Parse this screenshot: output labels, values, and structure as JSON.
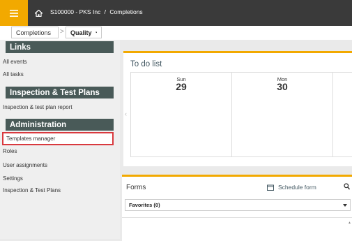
{
  "topbar": {
    "breadcrumb_project": "S100000 - PKS Inc",
    "breadcrumb_separator": "/",
    "breadcrumb_current": "Completions"
  },
  "navrow": {
    "module_label": "Completions",
    "separator": ">",
    "submodule_label": "Quality"
  },
  "sidebar": {
    "sections": [
      {
        "title": "Links",
        "items": [
          "All events",
          "All tasks"
        ]
      },
      {
        "title": "Inspection & Test Plans",
        "items": [
          "Inspection & test plan report"
        ]
      },
      {
        "title": "Administration",
        "items": [
          "Templates manager",
          "Roles",
          "User assignments",
          "Settings",
          "Inspection & Test Plans"
        ]
      }
    ],
    "active_item": "Templates manager"
  },
  "todo": {
    "title": "To do list",
    "days": [
      {
        "name": "Sun",
        "number": "29"
      },
      {
        "name": "Mon",
        "number": "30"
      }
    ]
  },
  "forms": {
    "title": "Forms",
    "schedule_label": "Schedule form",
    "favorites_label": "Favorites (0)"
  },
  "colors": {
    "accent": "#f2a900",
    "topbar": "#3a3a3a",
    "section_header": "#495a58",
    "active_outline": "#d9393e"
  },
  "icons": [
    "hamburger-menu-icon",
    "home-icon",
    "chevron-down-icon",
    "chevron-left-icon",
    "calendar-icon",
    "search-icon"
  ]
}
